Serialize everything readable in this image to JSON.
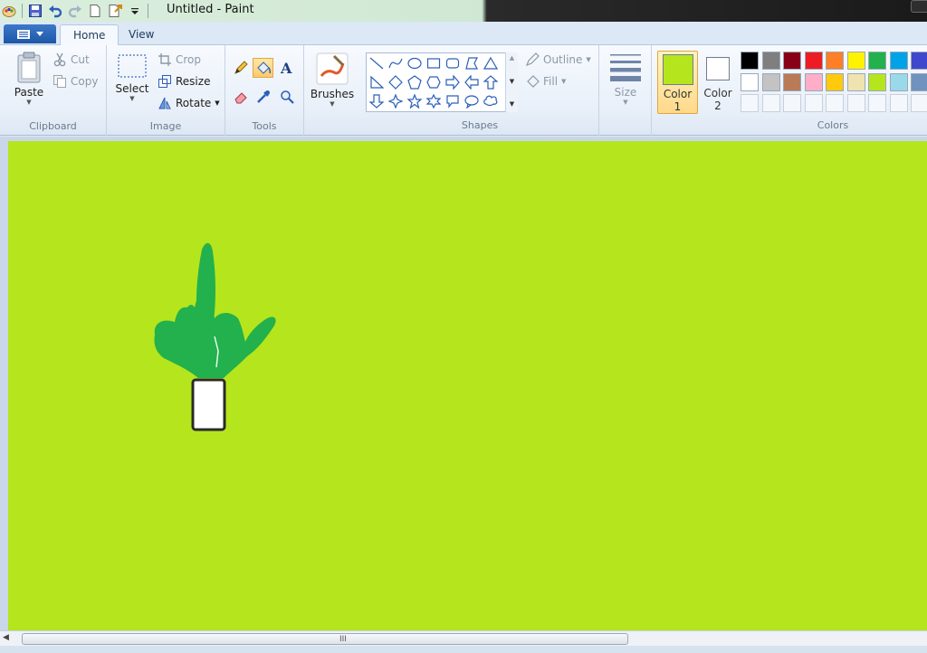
{
  "window": {
    "title": "Untitled - Paint"
  },
  "tabs": [
    {
      "label": "Home"
    },
    {
      "label": "View"
    }
  ],
  "ribbon": {
    "clipboard": {
      "label": "Clipboard",
      "paste": "Paste",
      "cut": "Cut",
      "copy": "Copy"
    },
    "image": {
      "label": "Image",
      "select": "Select",
      "crop": "Crop",
      "resize": "Resize",
      "rotate": "Rotate"
    },
    "tools": {
      "label": "Tools"
    },
    "brushes": {
      "label": "Brushes"
    },
    "shapes": {
      "label": "Shapes",
      "outline": "Outline",
      "fill": "Fill"
    },
    "size": {
      "label": "Size"
    },
    "color1": {
      "label": "Color",
      "num": "1",
      "value": "#b5e51d"
    },
    "color2": {
      "label": "Color",
      "num": "2",
      "value": "#ffffff"
    },
    "colors": {
      "label": "Colors"
    }
  },
  "palette": {
    "row1": [
      "#000000",
      "#7f7f7f",
      "#880015",
      "#ed1c24",
      "#ff7f27",
      "#fff200",
      "#22b14c",
      "#00a2e8",
      "#3f48cc"
    ],
    "row2": [
      "#ffffff",
      "#c3c3c3",
      "#b97a57",
      "#ffaec9",
      "#ffc90e",
      "#efe4b0",
      "#b5e61d",
      "#99d9ea",
      "#7092be"
    ]
  },
  "canvas": {
    "background": "#b5e51d",
    "foliage": "#22b14c"
  },
  "scrollbar": {
    "grip": "III"
  }
}
